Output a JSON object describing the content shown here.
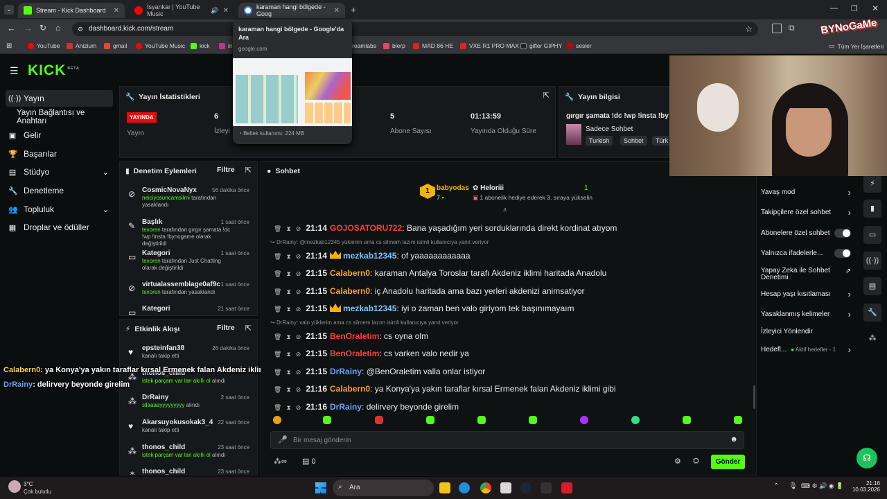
{
  "browser": {
    "tabs": [
      {
        "title": "Stream - Kick Dashboard",
        "color": "#53fc18"
      },
      {
        "title": "İsyankar | YouTube Music",
        "color": "#ff0000"
      },
      {
        "title": "karaman hangi bölgede - Goog",
        "color": "#4285f4"
      }
    ],
    "url": "dashboard.kick.com/stream",
    "bookmarks": [
      "YouTube",
      "Anizium",
      "gmail",
      "YouTube Music",
      "kick",
      "ins",
      "reamlabs",
      "blerp",
      "MAD 86 HE",
      "VXE R1 PRO MAX",
      "gifler GIPHY",
      "sesler",
      "Tüm Yer İşaretleri"
    ],
    "tooltip": {
      "title": "karaman hangi bölgede - Google'da Ara",
      "domain": "google.com",
      "memory": "Bellek kullanımı: 224 MB"
    }
  },
  "app": {
    "logo": "KICK",
    "logo_tag": "BETA"
  },
  "sidebar": {
    "items": [
      {
        "label": "Yayın",
        "icon": "broadcast-icon"
      },
      {
        "label": "Yayın Bağlantısı ve Anahtarı",
        "icon": ""
      },
      {
        "label": "Gelir",
        "icon": "money-icon"
      },
      {
        "label": "Başarılar",
        "icon": "trophy-icon"
      },
      {
        "label": "Stüdyo",
        "icon": "studio-icon"
      },
      {
        "label": "Denetleme",
        "icon": "wrench-icon"
      },
      {
        "label": "Topluluk",
        "icon": "people-icon"
      },
      {
        "label": "Droplar ve ödüller",
        "icon": "drops-icon"
      }
    ]
  },
  "stats": {
    "title": "Yayın İstatistikleri",
    "live_badge": "YAYINDA",
    "live_label": "Yayın",
    "viewers_value": "6",
    "viewers_label": "İzleyi",
    "subs_value": "5",
    "subs_label": "Abone Sayısı",
    "uptime_value": "01:13:59",
    "uptime_label": "Yayında Olduğu Süre"
  },
  "info": {
    "title": "Yayın bilgisi",
    "stream_title": "gırgır şamata !dc !wp !insta !bynog",
    "category": "Sadece Sohbet",
    "tags": [
      "Turkish",
      "Sohbet",
      "Türk"
    ]
  },
  "mod": {
    "title": "Denetim Eylemleri",
    "filter": "Filtre",
    "items": [
      {
        "name": "CosmicNovaNyx",
        "time": "56 dakika önce",
        "hl": "neiciyosuncamsilmi",
        "desc": " tarafından yasaklandı",
        "icon": "ban-icon"
      },
      {
        "name": "Başlık",
        "time": "1 saat önce",
        "hl": "texoren",
        "desc": " tarafından gırgır şamata !dc !wp !insta !bynogame olarak değiştirildi",
        "icon": "title-icon"
      },
      {
        "name": "Kategori",
        "time": "1 saat önce",
        "hl": "texoren",
        "desc": " tarafından Just Chatting olarak değiştirildi",
        "icon": "category-icon"
      },
      {
        "name": "virtualassemblage0af9c",
        "time": "1 saat önce",
        "hl": "texoren",
        "desc": " tarafından yasaklandı",
        "icon": "ban-icon"
      },
      {
        "name": "Kategori",
        "time": "21 saat önce",
        "hl": "",
        "desc": "",
        "icon": "category-icon"
      }
    ]
  },
  "activity": {
    "title": "Etkinlik Akışı",
    "filter": "Filtre",
    "items": [
      {
        "name": "epsteinfan38",
        "time": "26 dakika önce",
        "desc": "kanalı takip etti",
        "hl": "",
        "icon": "heart-icon"
      },
      {
        "name": "thonos_child",
        "time": "",
        "desc": " alındı",
        "hl": "istek parçam var lan akıllı ol",
        "icon": "drops-icon"
      },
      {
        "name": "DrRainy",
        "time": "2 saat önce",
        "desc": " alındı",
        "hl": "sllaaaayyyyyyyyy",
        "icon": "drops-icon"
      },
      {
        "name": "Akarsuyokusokak3_4",
        "time": "22 saat önce",
        "desc": "kanalı takip etti",
        "hl": "",
        "icon": "heart-icon"
      },
      {
        "name": "thonos_child",
        "time": "23 saat önce",
        "desc": " alındı",
        "hl": "istek parçam var lan akıllı ol",
        "icon": "drops-icon"
      },
      {
        "name": "thonos_child",
        "time": "23 saat önce",
        "desc": "",
        "hl": "",
        "icon": "drops-icon"
      }
    ]
  },
  "overlay": [
    {
      "user": "Calabern0",
      "text": ": ya Konya'ya yakın taraflar kırsal Ermenek falan Akdeniz iklimi gibi"
    },
    {
      "user": "DrRainy",
      "text": ": delirvery beyonde girelim"
    }
  ],
  "chat": {
    "title": "Sohbet",
    "pinned": {
      "user1": "babyodas",
      "count1": "7",
      "user2": "Heloriii",
      "count2": "1",
      "desc": "1 abonelik hediye ederek 3. sıraya yükselin",
      "badge": "1"
    },
    "messages": [
      {
        "time": "21:14",
        "user": "GOJOSATORU722",
        "text": ": Bana yaşadığım yeri sorduklarında direkt kordinat atıyom",
        "cls": "u-red"
      },
      {
        "reply": "DrRainy: @mezkab12345 yüklerim ama cs silmem lazım isimli kullanıcıya yanıt veriyor"
      },
      {
        "time": "21:14",
        "user": "mezkab12345",
        "text": ": of yaaaaaaaaaaaa",
        "cls": "u-bblue",
        "crown": true
      },
      {
        "time": "21:15",
        "user": "Calabern0",
        "text": ": karaman Antalya Toroslar tarafı Akdeniz iklimi haritada Anadolu",
        "cls": "u-orange"
      },
      {
        "time": "21:15",
        "user": "Calabern0",
        "text": ": iç Anadolu haritada ama bazı yerleri akdenizi animsatiyor",
        "cls": "u-orange"
      },
      {
        "time": "21:15",
        "user": "mezkab12345",
        "text": ": iyi o zaman ben valo giriyom tek başınımayaım",
        "cls": "u-bblue",
        "crown": true
      },
      {
        "reply": "DrRainy: valo yüklerim ama cs silmem lazım isimli kullanıcıya yanıt veriyor"
      },
      {
        "time": "21:15",
        "user": "BenOraletim",
        "text": ": cs oyna olm",
        "cls": "u-red"
      },
      {
        "time": "21:15",
        "user": "BenOraletim",
        "text": ": cs varken valo nedir ya",
        "cls": "u-red"
      },
      {
        "time": "21:15",
        "user": "DrRainy",
        "text": ": @BenOraletim valla onlar istiyor",
        "cls": "u-blue"
      },
      {
        "time": "21:16",
        "user": "Calabern0",
        "text": ": ya Konya'ya yakın taraflar kırsal Ermenek falan Akdeniz iklimi gibi",
        "cls": "u-orange"
      },
      {
        "time": "21:16",
        "user": "DrRainy",
        "text": ": delirvery beyonde girelim",
        "cls": "u-blue"
      }
    ],
    "input_placeholder": "Bir mesaj gönderin",
    "send": "Gönder",
    "points": "0"
  },
  "settings": {
    "items": [
      {
        "label": "Yavaş mod",
        "type": "chevron"
      },
      {
        "label": "Takipçilere özel sohbet",
        "type": "chevron"
      },
      {
        "label": "Abonelere özel sohbet",
        "type": "toggle"
      },
      {
        "label": "Yalnızca ifadelerle...",
        "type": "toggle"
      },
      {
        "label": "Yapay Zeka ile Sohbet Denetimi",
        "type": "external"
      },
      {
        "label": "Hesap yaşı kısıtlaması",
        "type": "chevron"
      },
      {
        "label": "Yasaklanmış kelimeler",
        "type": "chevron"
      },
      {
        "label": "İzleyici Yönlendir",
        "type": "none"
      },
      {
        "label": "Hedefl...",
        "type": "chevron",
        "extra": "Aktif hedefler - 1"
      }
    ]
  },
  "webcam": {
    "watermark": "BYNoGaMe"
  },
  "taskbar": {
    "weather_temp": "3°C",
    "weather_desc": "Çok bulutlu",
    "search": "Ara",
    "time": "21:16",
    "date": "10.03.2026"
  }
}
